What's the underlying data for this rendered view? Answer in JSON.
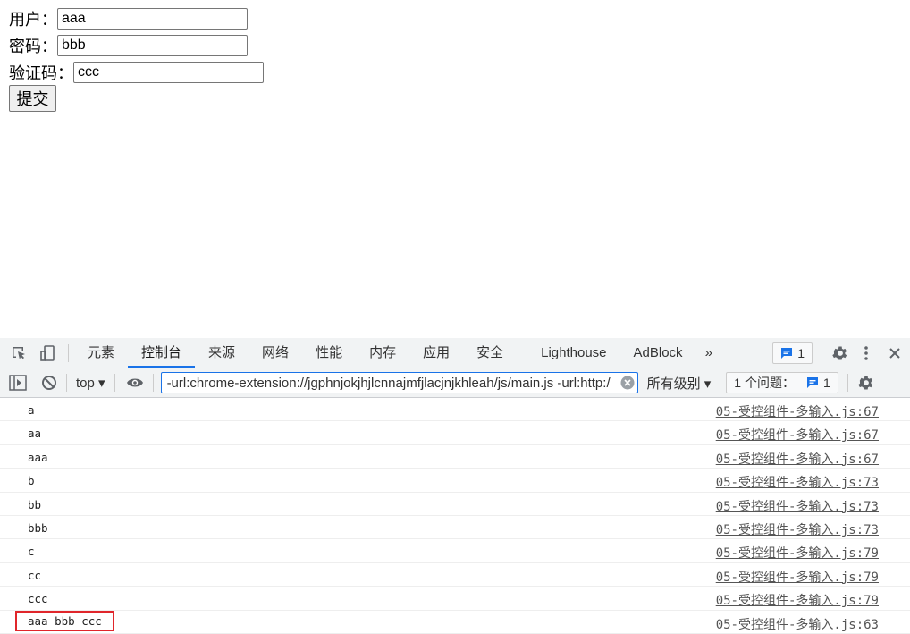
{
  "form": {
    "fields": [
      {
        "label": "用户：",
        "value": "aaa"
      },
      {
        "label": "密码：",
        "value": "bbb"
      },
      {
        "label": "验证码：",
        "value": "ccc"
      }
    ],
    "submit_label": "提交"
  },
  "devtools": {
    "tabs": [
      {
        "label": "元素",
        "active": false
      },
      {
        "label": "控制台",
        "active": true
      },
      {
        "label": "来源",
        "active": false
      },
      {
        "label": "网络",
        "active": false
      },
      {
        "label": "性能",
        "active": false
      },
      {
        "label": "内存",
        "active": false
      },
      {
        "label": "应用",
        "active": false
      },
      {
        "label": "安全",
        "active": false
      },
      {
        "label": "Lighthouse",
        "active": false
      },
      {
        "label": "AdBlock",
        "active": false
      }
    ],
    "more_tabs": "»",
    "issues_count": "1",
    "toolbar": {
      "context": "top",
      "filter_value": "-url:chrome-extension://jgphnjokjhjlcnnajmfjlacjnjkhleah/js/main.js -url:http:/",
      "levels": "所有级别",
      "issues_label": "1 个问题：",
      "issues_count": "1"
    },
    "accent_color": "#1a73e8",
    "highlight_color": "#e0262b",
    "logs": [
      {
        "message": "a",
        "source": "05-受控组件-多输入.js:67"
      },
      {
        "message": "aa",
        "source": "05-受控组件-多输入.js:67"
      },
      {
        "message": "aaa",
        "source": "05-受控组件-多输入.js:67"
      },
      {
        "message": "b",
        "source": "05-受控组件-多输入.js:73"
      },
      {
        "message": "bb",
        "source": "05-受控组件-多输入.js:73"
      },
      {
        "message": "bbb",
        "source": "05-受控组件-多输入.js:73"
      },
      {
        "message": "c",
        "source": "05-受控组件-多输入.js:79"
      },
      {
        "message": "cc",
        "source": "05-受控组件-多输入.js:79"
      },
      {
        "message": "ccc",
        "source": "05-受控组件-多输入.js:79"
      },
      {
        "message": "aaa bbb ccc",
        "source": "05-受控组件-多输入.js:63",
        "highlighted": true
      }
    ]
  }
}
